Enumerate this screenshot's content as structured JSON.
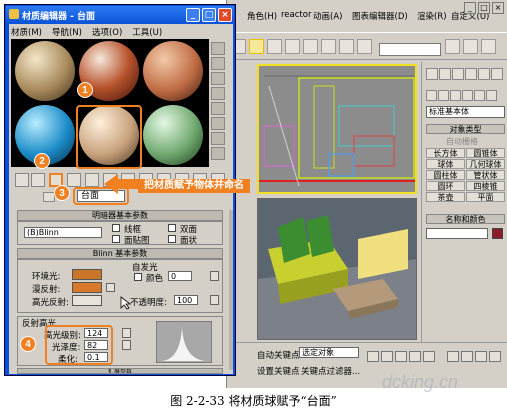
{
  "max": {
    "menu": [
      "角色(H)",
      "reactor",
      "动画(A)",
      "图表编辑器(D)",
      "渲染(R)",
      "自定义(U)"
    ],
    "cmd": {
      "dropdown": "标准基本体",
      "object_type": "对象类型",
      "autogrid": "自动栅格",
      "buttons": [
        "长方体",
        "圆锥体",
        "球体",
        "几何球体",
        "圆柱体",
        "管状体",
        "圆环",
        "四棱锥",
        "茶壶",
        "平面"
      ],
      "name_color": "名称和颜色"
    },
    "status": {
      "autokey": "自动关键点",
      "selected": "选定对象",
      "setkey": "设置关键点",
      "keyfilter": "关键点过滤器..."
    }
  },
  "med": {
    "title": "材质编辑器 - 台面",
    "menu": [
      "材质(M)",
      "导航(N)",
      "选项(O)",
      "工具(U)"
    ],
    "name_value": "台面",
    "shader_header": "明暗器基本参数",
    "shader_type": "(B)Blinn",
    "shader_opts": [
      "线框",
      "双面",
      "面贴图",
      "面状"
    ],
    "blinn_header": "Blinn 基本参数",
    "self_illum": "自发光",
    "color_label": "颜色",
    "color_value": "0",
    "ambient": "环境光:",
    "diffuse": "漫反射:",
    "specular": "高光反射:",
    "opacity_label": "不透明度:",
    "opacity_value": "100",
    "spec_header": "反射高光",
    "gloss_level_label": "高光级别:",
    "gloss_level": "124",
    "glossiness_label": "光泽度:",
    "glossiness": "82",
    "soften_label": "柔化:",
    "soften": "0.1",
    "ext_header": "扩展参数",
    "colors": {
      "diffuse": "#d97a2a",
      "ambient": "#c9762a",
      "specular": "#e8e4dc"
    }
  },
  "callouts": {
    "n1": "1",
    "n2": "2",
    "n3": "3",
    "n4": "4",
    "arrow_text": "把材质赋予物体并命名"
  },
  "caption": "图 2-2-33    将材质球赋予“台面”",
  "watermark": "dcking.cn"
}
